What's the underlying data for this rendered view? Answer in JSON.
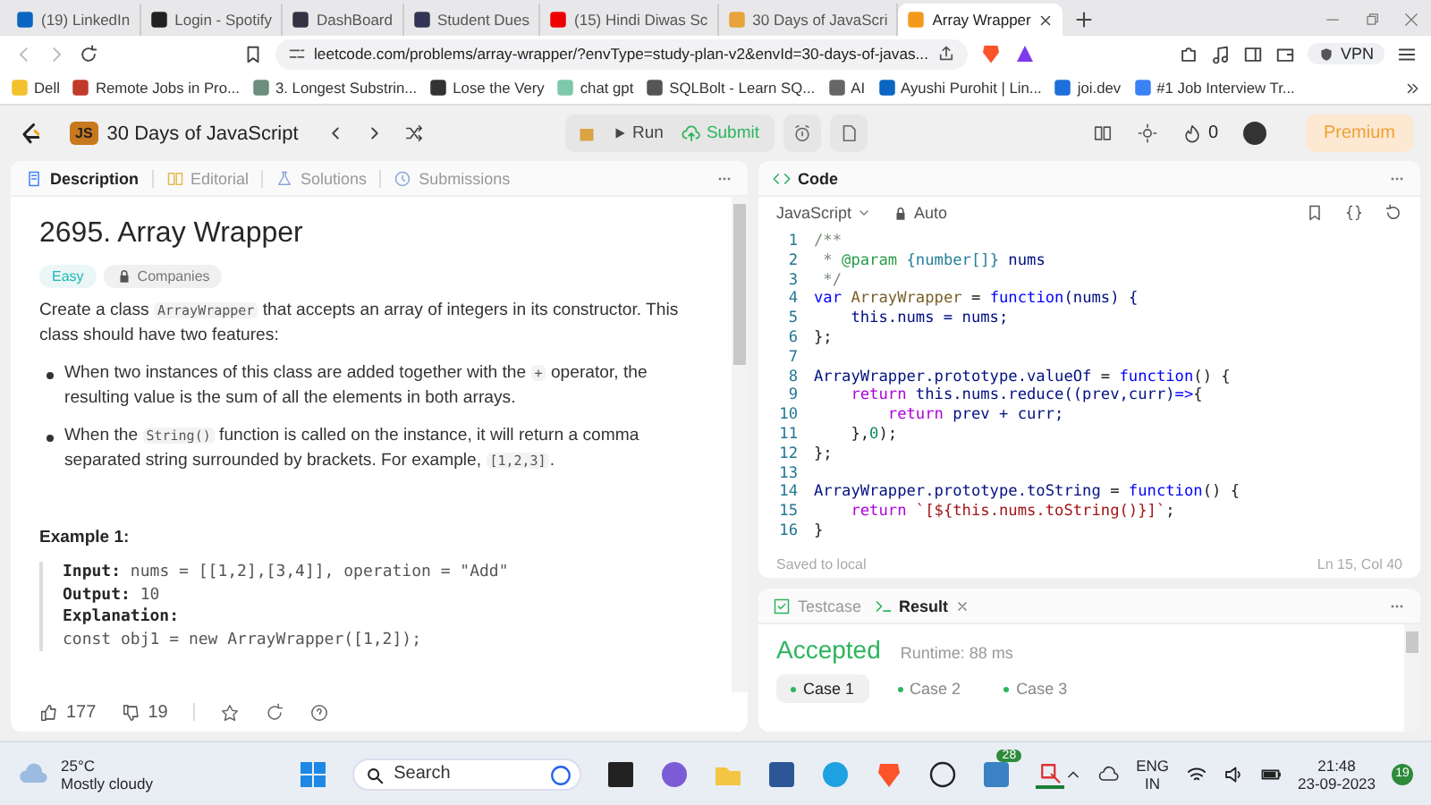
{
  "browser": {
    "tabs": [
      {
        "title": "(19) LinkedIn",
        "selected": false
      },
      {
        "title": "Login - Spotify",
        "selected": false
      },
      {
        "title": "DashBoard",
        "selected": false
      },
      {
        "title": "Student Dues",
        "selected": false
      },
      {
        "title": "(15) Hindi Diwas Sc",
        "selected": false
      },
      {
        "title": "30 Days of JavaScri",
        "selected": false
      },
      {
        "title": "Array Wrapper",
        "selected": true
      }
    ],
    "url": "leetcode.com/problems/array-wrapper/?envType=study-plan-v2&envId=30-days-of-javas...",
    "vpn": "VPN",
    "bookmarks": [
      "Dell",
      "Remote Jobs in Pro...",
      "3. Longest Substrin...",
      "Lose the Very",
      "chat gpt",
      "SQLBolt - Learn SQ...",
      "AI",
      "Ayushi Purohit | Lin...",
      "joi.dev",
      "#1 Job Interview Tr..."
    ]
  },
  "app": {
    "logo": "JS",
    "title": "30 Days of JavaScript",
    "run": "Run",
    "submit": "Submit",
    "streak": "0",
    "premium": "Premium"
  },
  "description": {
    "tabs": [
      {
        "label": "Description",
        "selected": true
      },
      {
        "label": "Editorial",
        "selected": false
      },
      {
        "label": "Solutions",
        "selected": false
      },
      {
        "label": "Submissions",
        "selected": false
      }
    ],
    "title": "2695. Array Wrapper",
    "difficulty": "Easy",
    "companies": "Companies",
    "paragraphs": [
      {
        "kind": "text",
        "segments": [
          {
            "kind": "text",
            "text": "Create a class "
          },
          {
            "kind": "code",
            "text": "ArrayWrapper"
          },
          {
            "kind": "text",
            "text": " that accepts an array of integers in its constructor. This class should have two features:"
          }
        ]
      },
      {
        "kind": "bullet",
        "segments": [
          {
            "kind": "text",
            "text": "When two instances of this class are added together with the "
          },
          {
            "kind": "code",
            "text": "+"
          },
          {
            "kind": "text",
            "text": " operator, the resulting value is the sum of all the elements in both arrays."
          }
        ]
      },
      {
        "kind": "bullet",
        "segments": [
          {
            "kind": "text",
            "text": "When the "
          },
          {
            "kind": "code",
            "text": "String()"
          },
          {
            "kind": "text",
            "text": " function is called on the instance, it will return a comma separated string surrounded by brackets. For example, "
          },
          {
            "kind": "code",
            "text": "[1,2,3]"
          },
          {
            "kind": "text",
            "text": "."
          }
        ]
      }
    ],
    "example_title": "Example 1:",
    "example_lines": [
      {
        "label": "Input:",
        "value": " nums = [[1,2],[3,4]], operation = \"Add\""
      },
      {
        "label": "Output:",
        "value": " 10"
      },
      {
        "label": "Explanation:"
      },
      {
        "value": "const obj1 = new ArrayWrapper([1,2]);"
      }
    ],
    "likes": "177",
    "dislikes": "19"
  },
  "code": {
    "title": "Code",
    "language": "JavaScript",
    "mode": "Auto",
    "lines": [
      {
        "n": "1",
        "tokens": [
          {
            "kind": "comment",
            "text": "/**"
          }
        ]
      },
      {
        "n": "2",
        "tokens": [
          {
            "kind": "comment",
            "text": " * "
          },
          {
            "kind": "doctag",
            "text": "@param"
          },
          {
            "kind": "doctype",
            "text": " {number[]}"
          },
          {
            "kind": "ident",
            "text": " nums"
          }
        ]
      },
      {
        "n": "3",
        "tokens": [
          {
            "kind": "comment",
            "text": " */"
          }
        ]
      },
      {
        "n": "4",
        "tokens": [
          {
            "kind": "keyword",
            "text": "var"
          },
          {
            "kind": "class",
            "text": " ArrayWrapper"
          },
          {
            "kind": "plain",
            "text": " = "
          },
          {
            "kind": "keyword",
            "text": "function"
          },
          {
            "kind": "ident",
            "text": "(nums) {"
          }
        ]
      },
      {
        "n": "5",
        "tokens": [
          {
            "kind": "ident",
            "text": "    this.nums = nums;"
          }
        ]
      },
      {
        "n": "6",
        "tokens": [
          {
            "kind": "plain",
            "text": "};"
          }
        ]
      },
      {
        "n": "7"
      },
      {
        "n": "8",
        "tokens": [
          {
            "kind": "ident",
            "text": "ArrayWrapper.prototype.valueOf"
          },
          {
            "kind": "plain",
            "text": " = "
          },
          {
            "kind": "keyword",
            "text": "function"
          },
          {
            "kind": "plain",
            "text": "() {"
          }
        ]
      },
      {
        "n": "9",
        "tokens": [
          {
            "kind": "control",
            "text": "    return"
          },
          {
            "kind": "ident",
            "text": " this.nums.reduce((prev,curr)"
          },
          {
            "kind": "keyword",
            "text": "=>"
          },
          {
            "kind": "plain",
            "text": "{"
          }
        ]
      },
      {
        "n": "10",
        "tokens": [
          {
            "kind": "control",
            "text": "        return"
          },
          {
            "kind": "ident",
            "text": " prev + curr;"
          }
        ]
      },
      {
        "n": "11",
        "tokens": [
          {
            "kind": "plain",
            "text": "    },"
          },
          {
            "kind": "number",
            "text": "0"
          },
          {
            "kind": "plain",
            "text": ");"
          }
        ]
      },
      {
        "n": "12",
        "tokens": [
          {
            "kind": "plain",
            "text": "};"
          }
        ]
      },
      {
        "n": "13"
      },
      {
        "n": "14",
        "tokens": [
          {
            "kind": "ident",
            "text": "ArrayWrapper.prototype.toString"
          },
          {
            "kind": "plain",
            "text": " = "
          },
          {
            "kind": "keyword",
            "text": "function"
          },
          {
            "kind": "plain",
            "text": "() {"
          }
        ]
      },
      {
        "n": "15",
        "tokens": [
          {
            "kind": "control",
            "text": "    return"
          },
          {
            "kind": "string",
            "text": " `[${this.nums.toString()}]`"
          },
          {
            "kind": "plain",
            "text": ";"
          }
        ]
      },
      {
        "n": "16",
        "tokens": [
          {
            "kind": "plain",
            "text": "}"
          }
        ]
      }
    ],
    "saved": "Saved to local",
    "cursor": "Ln 15, Col 40"
  },
  "result": {
    "tabs": [
      {
        "label": "Testcase",
        "selected": false
      },
      {
        "label": "Result",
        "selected": true
      }
    ],
    "status": "Accepted",
    "runtime": "Runtime: 88 ms",
    "cases": [
      {
        "label": "Case 1",
        "selected": true
      },
      {
        "label": "Case 2",
        "selected": false
      },
      {
        "label": "Case 3",
        "selected": false
      }
    ]
  },
  "taskbar": {
    "temperature": "25°C",
    "weather": "Mostly cloudy",
    "search_placeholder": "Search",
    "app_badge": "28",
    "language": "ENG",
    "region": "IN",
    "time": "21:48",
    "date": "23-09-2023",
    "notifications": "19"
  }
}
